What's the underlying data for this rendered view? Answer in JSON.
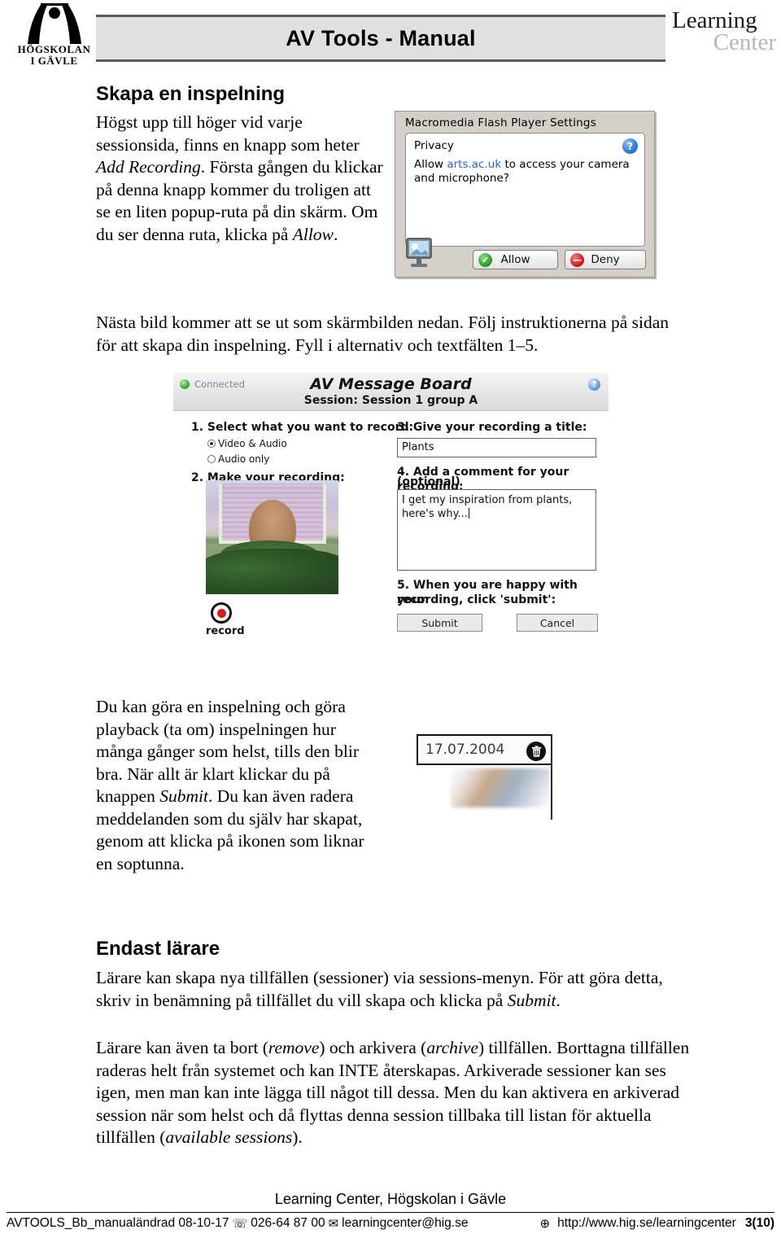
{
  "header": {
    "university_logo_line1": "HÖGSKOLAN",
    "university_logo_line2": "I GÄVLE",
    "title": "AV Tools - Manual",
    "brand_line1": "Learning",
    "brand_line2": "Center"
  },
  "section1": {
    "heading": "Skapa en inspelning",
    "paragraph_part1": "Högst upp till höger vid varje sessionsida, finns en knapp som heter ",
    "paragraph_italic1": "Add Recording",
    "paragraph_part2": ". Första gången du klickar på denna knapp kommer du troligen att se en liten popup-ruta på din skärm. Om du ser denna ruta, klicka på ",
    "paragraph_italic2": "Allow",
    "paragraph_part3": "."
  },
  "flash_dialog": {
    "title": "Macromedia Flash Player Settings",
    "section_label": "Privacy",
    "question_pre": "Allow ",
    "question_domain": "arts.ac.uk",
    "question_post": " to access your camera and microphone?",
    "help_glyph": "?",
    "allow_label": "Allow",
    "deny_label": "Deny",
    "allow_glyph": "✔",
    "deny_glyph": "—"
  },
  "section2": {
    "paragraph": "Nästa bild kommer att se ut som skärmbilden nedan. Följ instruktionerna på sidan för att skapa din inspelning. Fyll i alternativ och textfälten 1–5."
  },
  "message_board": {
    "connection_status": "Connected",
    "title": "AV Message Board",
    "subtitle": "Session: Session 1  group A",
    "help_glyph": "?",
    "step1": "1.  Select what you want to record:",
    "option_video_audio": "Video & Audio",
    "option_audio_only": "Audio only",
    "step2": "2.  Make your recording:",
    "record_label": "record",
    "step3": "3.  Give your recording a title:",
    "title_value": "Plants",
    "step4_line1": "4.  Add a comment for your recording:",
    "step4_line2": "(optional)",
    "comment_value": "I get my inspiration from plants, here's why...",
    "step5_line1": "5.  When you are happy with your",
    "step5_line2": "recording, click 'submit':",
    "submit_label": "Submit",
    "cancel_label": "Cancel"
  },
  "section3": {
    "paragraph_part1": "Du kan göra en inspelning och göra playback (ta om) inspelningen hur många gånger som helst, tills den blir bra. När allt är klart klickar du på knappen ",
    "paragraph_italic1": "Submit",
    "paragraph_part2": ". Du kan även radera meddelanden som du själv har skapat, genom att klicka på ikonen som liknar en soptunna."
  },
  "date_shot": {
    "date": "17.07.2004",
    "trash_glyph": "🗑"
  },
  "section4": {
    "heading": "Endast lärare",
    "paragraph1_part1": "Lärare kan skapa nya tillfällen (sessioner) via sessions-menyn. För att göra detta, skriv in benämning på tillfället du vill skapa och klicka på ",
    "paragraph1_italic": "Submit",
    "paragraph1_part2": ".",
    "paragraph2_part1": "Lärare kan även ta bort (",
    "paragraph2_italic1": "remove",
    "paragraph2_part2": ") och arkivera (",
    "paragraph2_italic2": "archive",
    "paragraph2_part3": ") tillfällen. Borttagna tillfällen raderas helt från systemet och kan INTE återskapas. Arkiverade sessioner kan ses igen, men man kan inte lägga till något till dessa. Men du kan aktivera en arkiverad session när som helst och då flyttas denna session tillbaka till listan för aktuella tillfällen (",
    "paragraph2_italic3": "available sessions",
    "paragraph2_part4": ")."
  },
  "footer": {
    "center_title": "Learning Center, Högskolan i Gävle",
    "doc_id": "AVTOOLS_Bb_manualändrad 08-10-17",
    "phone_icon": "☏",
    "phone": "026-64 87 00",
    "mail_icon": "✉",
    "email": "learningcenter@hig.se",
    "globe_icon": "⊕",
    "url": "http://www.hig.se/learningcenter",
    "page": "3(10)"
  }
}
